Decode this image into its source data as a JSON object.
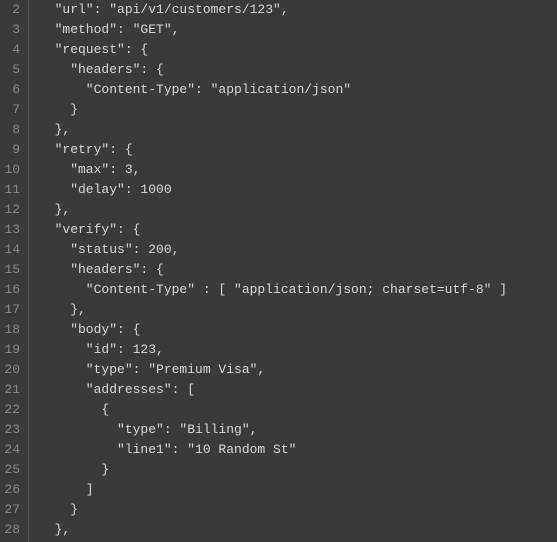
{
  "gutter": {
    "start": 2,
    "end": 28
  },
  "lines": [
    "  \"url\": \"api/v1/customers/123\",",
    "  \"method\": \"GET\",",
    "  \"request\": {",
    "    \"headers\": {",
    "      \"Content-Type\": \"application/json\"",
    "    }",
    "  },",
    "  \"retry\": {",
    "    \"max\": 3,",
    "    \"delay\": 1000",
    "  },",
    "  \"verify\": {",
    "    \"status\": 200,",
    "    \"headers\": {",
    "      \"Content-Type\" : [ \"application/json; charset=utf-8\" ]",
    "    },",
    "    \"body\": {",
    "      \"id\": 123,",
    "      \"type\": \"Premium Visa\",",
    "      \"addresses\": [",
    "        {",
    "          \"type\": \"Billing\",",
    "          \"line1\": \"10 Random St\"",
    "        }",
    "      ]",
    "    }",
    "  },"
  ]
}
